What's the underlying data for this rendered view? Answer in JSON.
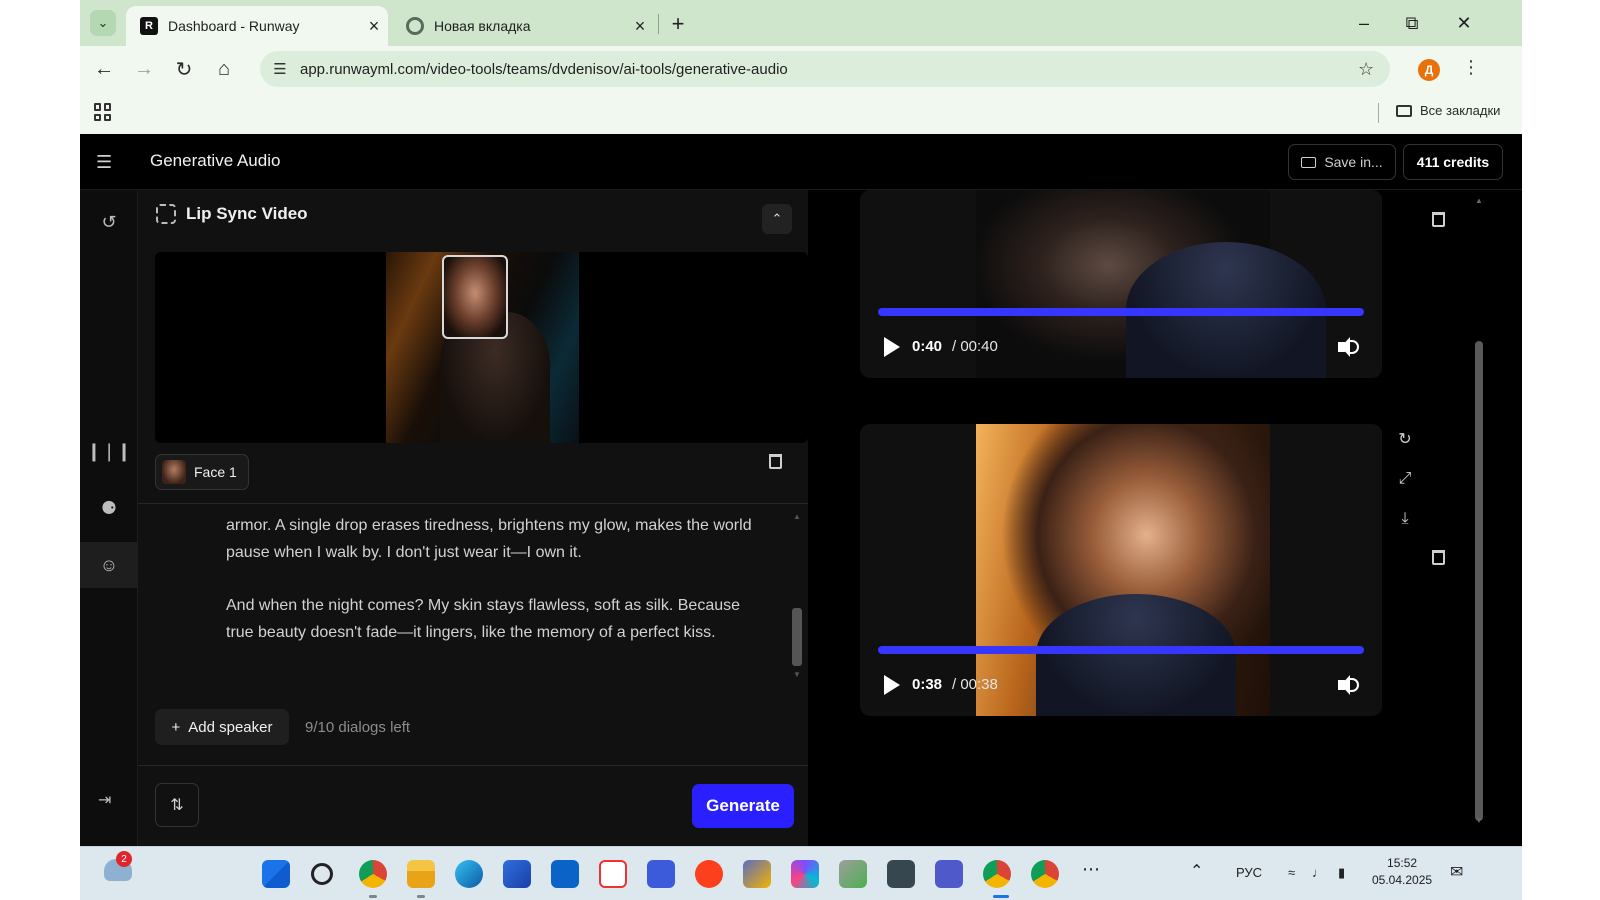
{
  "browser": {
    "tabs": [
      {
        "title": "Dashboard - Runway",
        "favicon": "R",
        "active": true
      },
      {
        "title": "Новая вкладка",
        "active": false
      }
    ],
    "url": "app.runwayml.com/video-tools/teams/dvdenisov/ai-tools/generative-audio",
    "profile_initial": "Д",
    "bookmarks_label": "Все закладки"
  },
  "app": {
    "title": "Generative Audio",
    "save_label": "Save in...",
    "credits_label": "411 credits"
  },
  "panel": {
    "section_title": "Lip Sync Video",
    "face_label": "Face 1",
    "script_paragraphs": [
      "armor. A single drop erases tiredness, brightens my glow, makes the world pause when I walk by. I don't just wear it—I own it.",
      "And when the night comes? My skin stays flawless, soft as silk. Because true beauty doesn't fade—it lingers, like the memory of a perfect kiss."
    ],
    "add_speaker_label": "Add speaker",
    "dialogs_left": "9/10 dialogs left",
    "generate_label": "Generate"
  },
  "results": [
    {
      "current": "0:40",
      "total": "/ 00:40",
      "progress": 1.0
    },
    {
      "current": "0:38",
      "total": "/ 00:38",
      "progress": 1.0
    }
  ],
  "taskbar": {
    "notification_count": "2",
    "lang": "РУС",
    "time": "15:52",
    "date": "05.04.2025"
  },
  "colors": {
    "accent": "#2a1fff",
    "progress": "#3636ff",
    "tab_strip": "#cfe6cd"
  }
}
